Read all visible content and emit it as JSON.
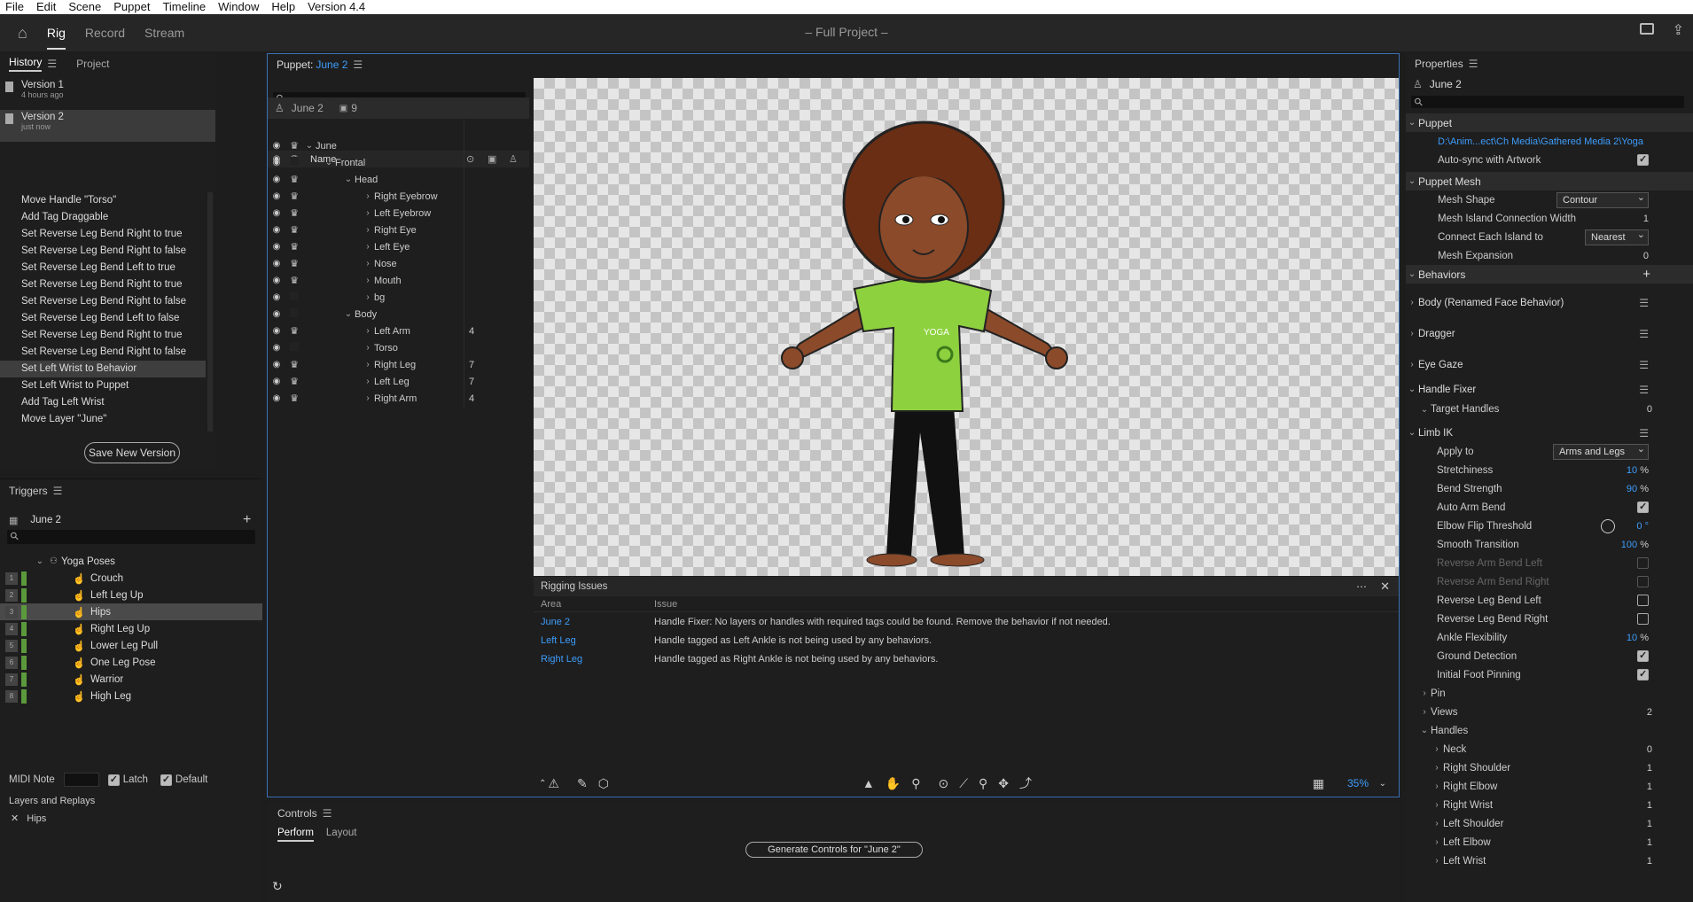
{
  "menu": [
    "File",
    "Edit",
    "Scene",
    "Puppet",
    "Timeline",
    "Window",
    "Help",
    "Version 4.4"
  ],
  "workspace_tabs": [
    "Rig",
    "Record",
    "Stream"
  ],
  "project_title": "– Full Project –",
  "history": {
    "tab_history": "History",
    "tab_project": "Project",
    "versions": [
      {
        "title": "Version 1",
        "sub": "4 hours ago"
      },
      {
        "title": "Version 2",
        "sub": "just now"
      }
    ],
    "items": [
      "Move Handle \"Torso\"",
      "Add Tag Draggable",
      "Set Reverse Leg Bend Right to true",
      "Set Reverse Leg Bend Right to false",
      "Set Reverse Leg Bend Left to true",
      "Set Reverse Leg Bend Right to true",
      "Set Reverse Leg Bend Right to false",
      "Set Reverse Leg Bend Left to false",
      "Set Reverse Leg Bend Right to true",
      "Set Reverse Leg Bend Right to false",
      "Set Left Wrist to Behavior",
      "Set Left Wrist to Puppet",
      "Add Tag Left Wrist",
      "Move Layer \"June\""
    ],
    "save_btn": "Save New Version"
  },
  "triggers": {
    "title": "Triggers",
    "puppet": "June 2",
    "group": "Yoga Poses",
    "items": [
      {
        "n": "1",
        "label": "Crouch"
      },
      {
        "n": "2",
        "label": "Left Leg Up"
      },
      {
        "n": "3",
        "label": "Hips"
      },
      {
        "n": "4",
        "label": "Right Leg Up"
      },
      {
        "n": "5",
        "label": "Lower Leg Pull"
      },
      {
        "n": "6",
        "label": "One Leg Pose"
      },
      {
        "n": "7",
        "label": "Warrior"
      },
      {
        "n": "8",
        "label": "High Leg"
      }
    ],
    "midi": "MIDI Note",
    "latch": "Latch",
    "default": "Default",
    "layers_replays": "Layers and Replays",
    "replay_item": "Hips"
  },
  "puppet": {
    "label": "Puppet:",
    "name": "June 2",
    "crumb_name": "June 2",
    "crumb_count": "9",
    "name_col": "Name",
    "layers": [
      {
        "label": "June",
        "indent": 0,
        "count": ""
      },
      {
        "label": "Frontal",
        "indent": 1,
        "count": ""
      },
      {
        "label": "Head",
        "indent": 2,
        "count": ""
      },
      {
        "label": "Right Eyebrow",
        "indent": 3,
        "count": ""
      },
      {
        "label": "Left Eyebrow",
        "indent": 3,
        "count": ""
      },
      {
        "label": "Right Eye",
        "indent": 3,
        "count": ""
      },
      {
        "label": "Left Eye",
        "indent": 3,
        "count": ""
      },
      {
        "label": "Nose",
        "indent": 3,
        "count": ""
      },
      {
        "label": "Mouth",
        "indent": 3,
        "count": ""
      },
      {
        "label": "bg",
        "indent": 3,
        "count": ""
      },
      {
        "label": "Body",
        "indent": 2,
        "count": ""
      },
      {
        "label": "Left Arm",
        "indent": 3,
        "count": "4"
      },
      {
        "label": "Torso",
        "indent": 3,
        "count": ""
      },
      {
        "label": "Right Leg",
        "indent": 3,
        "count": "7"
      },
      {
        "label": "Left Leg",
        "indent": 3,
        "count": "7"
      },
      {
        "label": "Right Arm",
        "indent": 3,
        "count": "4"
      }
    ]
  },
  "rigging": {
    "title": "Rigging Issues",
    "col_area": "Area",
    "col_issue": "Issue",
    "rows": [
      {
        "area": "June 2",
        "issue": "Handle Fixer: No layers or handles with required tags could be found. Remove the behavior if not needed."
      },
      {
        "area": "Left Leg",
        "issue": "Handle tagged as Left Ankle is not being used by any behaviors."
      },
      {
        "area": "Right Leg",
        "issue": "Handle tagged as Right Ankle is not being used by any behaviors."
      }
    ]
  },
  "zoom": "35%",
  "controls": {
    "title": "Controls",
    "tab_perform": "Perform",
    "tab_layout": "Layout",
    "generate": "Generate Controls for \"June 2\""
  },
  "properties": {
    "title": "Properties",
    "puppet_name": "June 2",
    "sec_puppet": "Puppet",
    "path": "D:\\Anim...ect\\Ch Media\\Gathered Media 2\\Yoga",
    "autosync": "Auto-sync with Artwork",
    "sec_mesh": "Puppet Mesh",
    "mesh_shape": "Mesh Shape",
    "mesh_shape_val": "Contour",
    "island_width": "Mesh Island Connection Width",
    "island_width_val": "1",
    "connect": "Connect Each Island to",
    "connect_val": "Nearest",
    "expansion": "Mesh Expansion",
    "expansion_val": "0",
    "sec_behaviors": "Behaviors",
    "beh_body": "Body (Renamed Face Behavior)",
    "beh_dragger": "Dragger",
    "beh_eyegaze": "Eye Gaze",
    "beh_handlefixer": "Handle Fixer",
    "target_handles": "Target Handles",
    "target_handles_val": "0",
    "beh_limbik": "Limb IK",
    "apply_to": "Apply to",
    "apply_to_val": "Arms and Legs",
    "stretch": "Stretchiness",
    "stretch_val": "10",
    "bend": "Bend Strength",
    "bend_val": "90",
    "auto_arm": "Auto Arm Bend",
    "elbow_flip": "Elbow Flip Threshold",
    "elbow_flip_val": "0",
    "smooth": "Smooth Transition",
    "smooth_val": "100",
    "rev_arm_l": "Reverse Arm Bend Left",
    "rev_arm_r": "Reverse Arm Bend Right",
    "rev_leg_l": "Reverse Leg Bend Left",
    "rev_leg_r": "Reverse Leg Bend Right",
    "ankle": "Ankle Flexibility",
    "ankle_val": "10",
    "ground": "Ground Detection",
    "foot_pin": "Initial Foot Pinning",
    "pin": "Pin",
    "views": "Views",
    "views_val": "2",
    "handles": "Handles",
    "handle_list": [
      {
        "n": "Neck",
        "v": "0"
      },
      {
        "n": "Right Shoulder",
        "v": "1"
      },
      {
        "n": "Right Elbow",
        "v": "1"
      },
      {
        "n": "Right Wrist",
        "v": "1"
      },
      {
        "n": "Left Shoulder",
        "v": "1"
      },
      {
        "n": "Left Elbow",
        "v": "1"
      },
      {
        "n": "Left Wrist",
        "v": "1"
      }
    ]
  },
  "colors": {
    "accent": "#3d9dfb",
    "trigger_green": "#5b9a3c",
    "shirt": "#8ed13f"
  }
}
